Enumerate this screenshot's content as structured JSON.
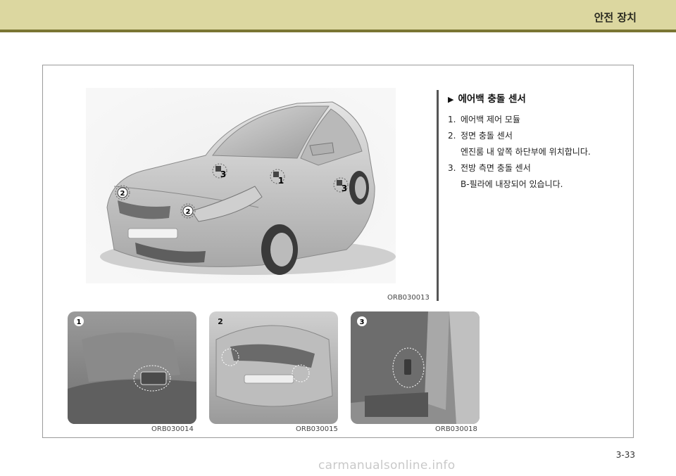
{
  "header": {
    "section_title": "안전 장치"
  },
  "main_figure": {
    "code": "ORB030013",
    "callouts": [
      "1",
      "2",
      "2",
      "3",
      "3"
    ]
  },
  "info": {
    "title": "에어백 충돌 센서",
    "items": [
      {
        "num": "1.",
        "text": "에어백 제어 모듈"
      },
      {
        "num": "2.",
        "text": "정면 충돌 센서"
      },
      {
        "num": "",
        "text": "엔진룸 내 앞쪽 하단부에 위치합니다."
      },
      {
        "num": "3.",
        "text": "전방 측면 충돌 센서"
      },
      {
        "num": "",
        "text": "B-필라에 내장되어 있습니다."
      }
    ]
  },
  "thumbnails": [
    {
      "label": "1",
      "code": "ORB030014"
    },
    {
      "label": "2",
      "code": "ORB030015"
    },
    {
      "label": "3",
      "code": "ORB030018"
    }
  ],
  "footer": {
    "page_number": "3-33",
    "watermark": "carmanualsonline.info"
  }
}
